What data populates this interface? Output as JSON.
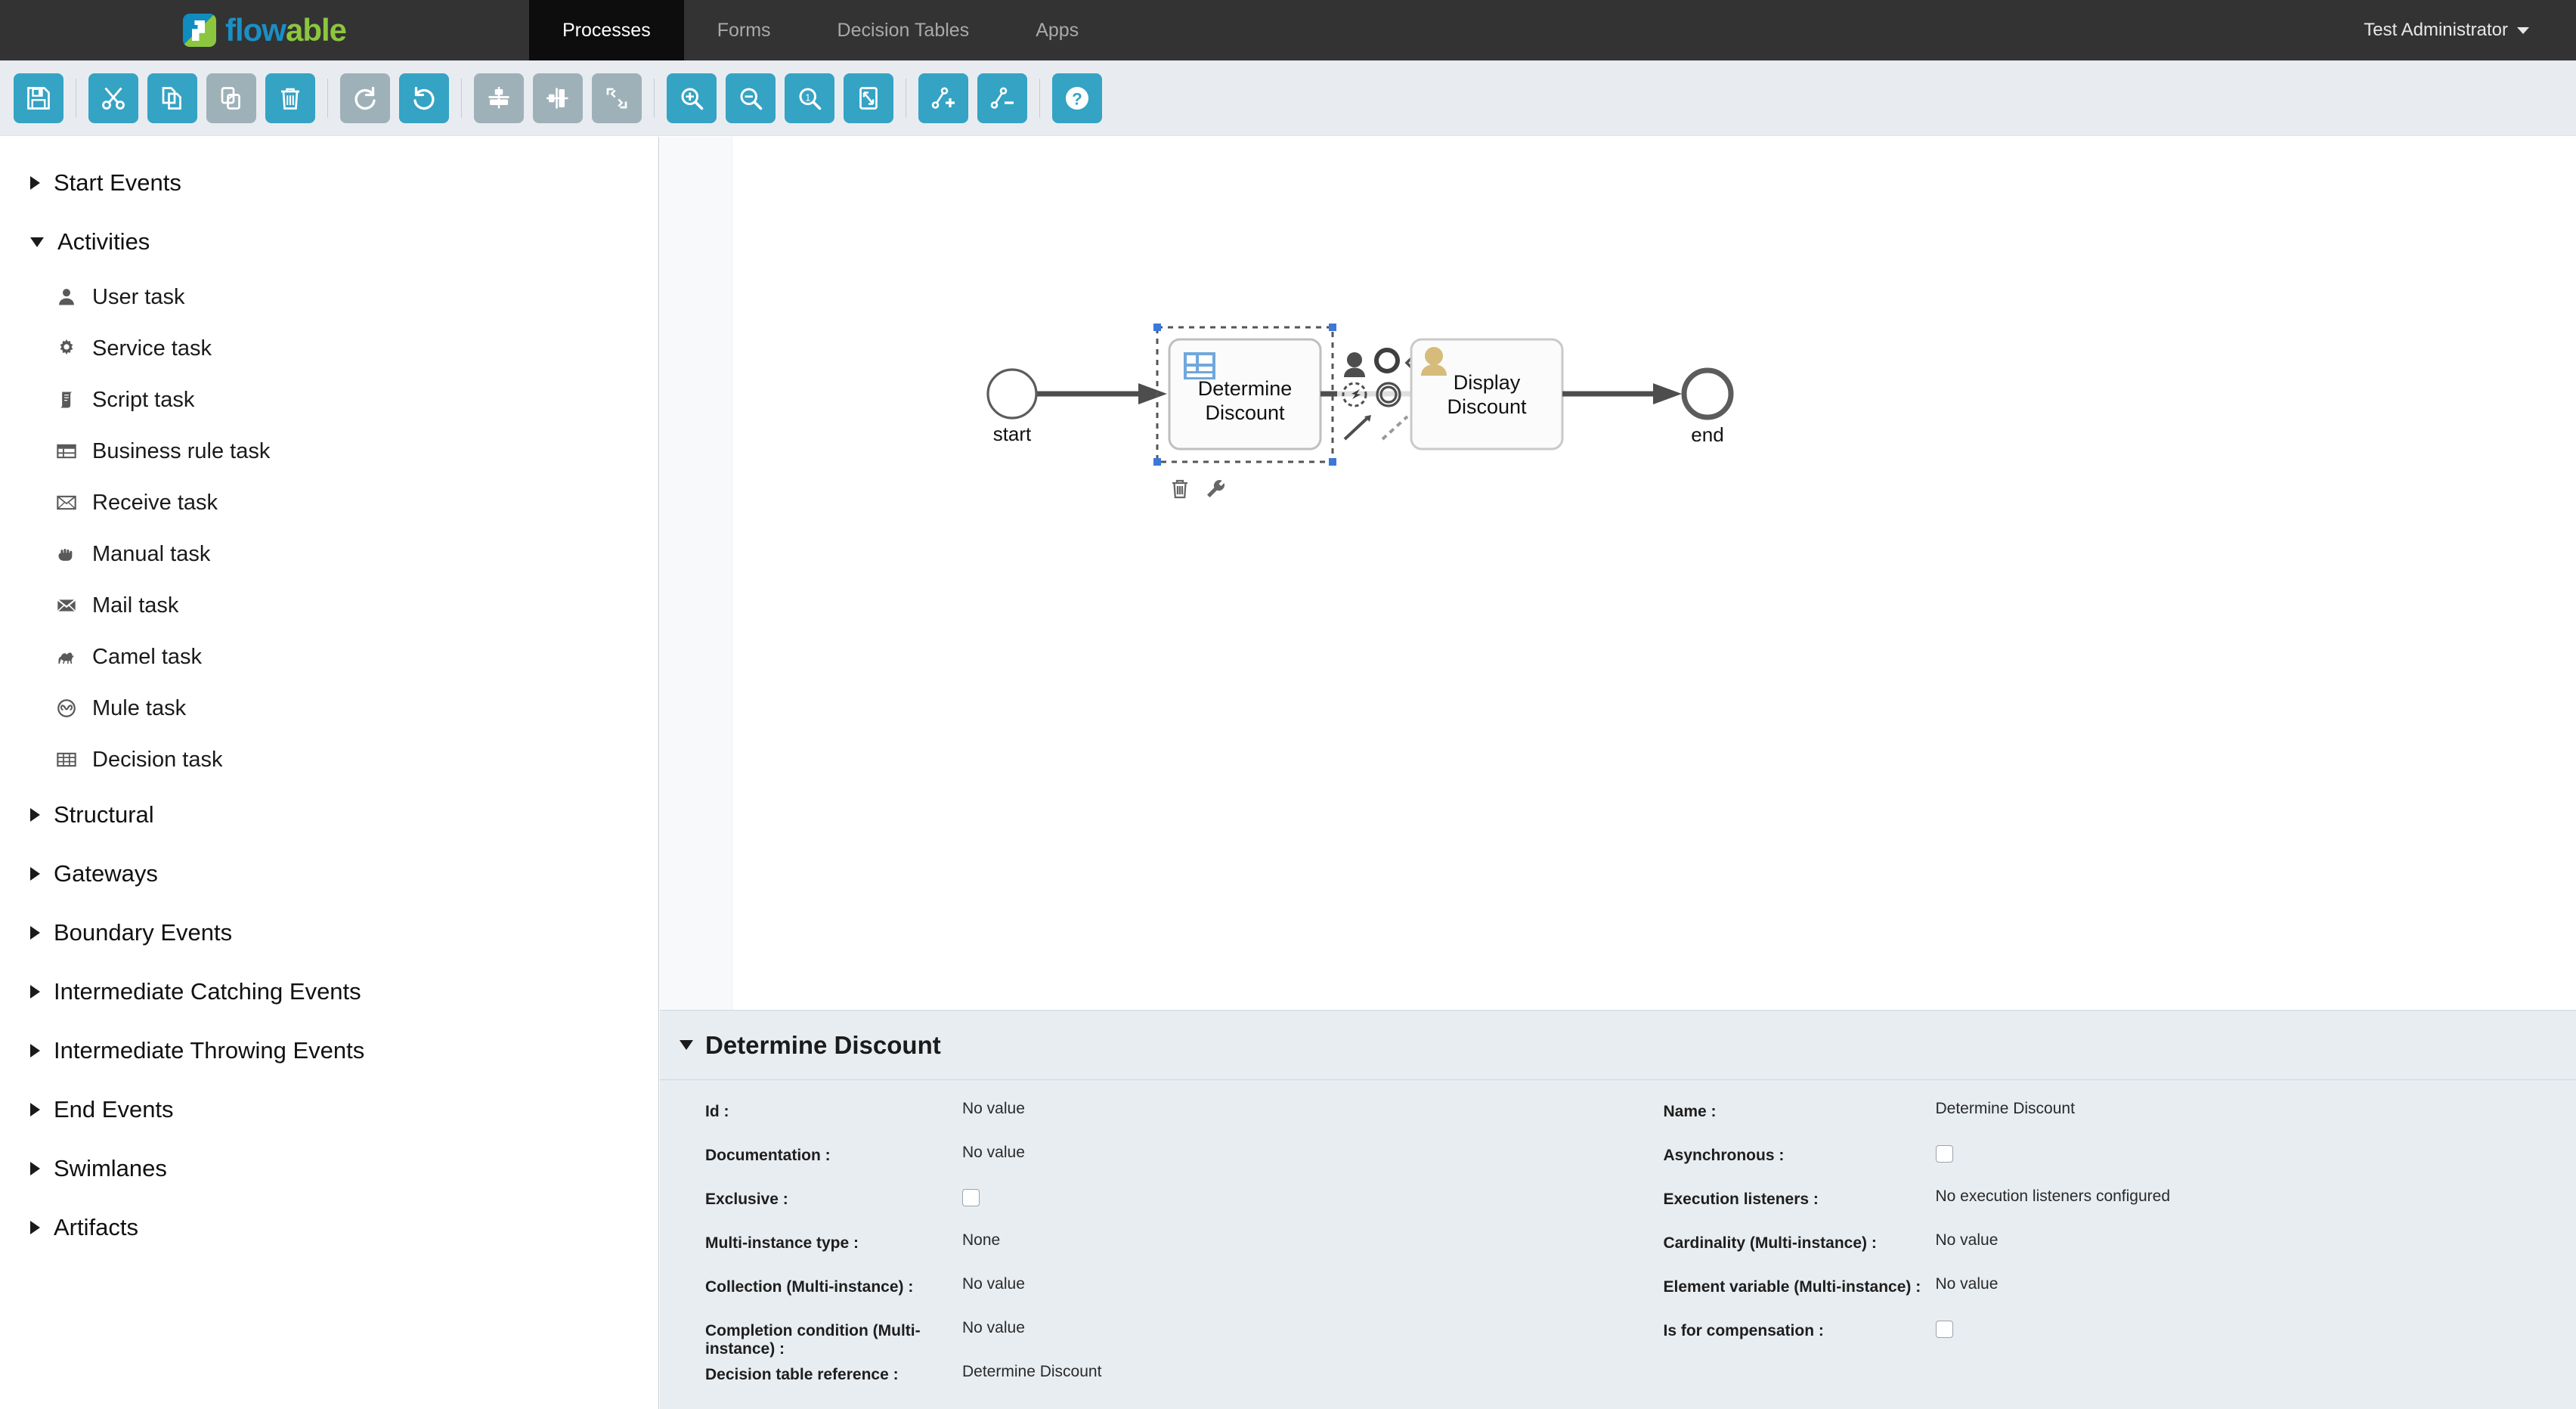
{
  "brand": {
    "name_blue": "flow",
    "name_green": "able",
    "logo_icon": "flowable-logo-icon"
  },
  "nav": {
    "tabs": [
      {
        "label": "Processes",
        "active": true
      },
      {
        "label": "Forms",
        "active": false
      },
      {
        "label": "Decision Tables",
        "active": false
      },
      {
        "label": "Apps",
        "active": false
      }
    ],
    "user": "Test Administrator"
  },
  "toolbar": {
    "colors": {
      "enabled": "#35a3c4",
      "disabled": "#9fb1b8",
      "background": "#e8ecf0"
    },
    "buttons": [
      {
        "name": "save-button",
        "icon": "save-icon",
        "enabled": true
      },
      {
        "sep": true
      },
      {
        "name": "cut-button",
        "icon": "scissors-icon",
        "enabled": true
      },
      {
        "name": "copy-button",
        "icon": "copy-icon",
        "enabled": true
      },
      {
        "name": "paste-button",
        "icon": "paste-icon",
        "enabled": false
      },
      {
        "name": "delete-button",
        "icon": "trash-icon",
        "enabled": true
      },
      {
        "sep": true
      },
      {
        "name": "redo-button",
        "icon": "redo-icon",
        "enabled": false
      },
      {
        "name": "undo-button",
        "icon": "undo-icon",
        "enabled": true
      },
      {
        "sep": true
      },
      {
        "name": "align-vertical-button",
        "icon": "align-vertical-icon",
        "enabled": false
      },
      {
        "name": "align-horizontal-button",
        "icon": "align-horizontal-icon",
        "enabled": false
      },
      {
        "name": "same-size-button",
        "icon": "same-size-icon",
        "enabled": false
      },
      {
        "sep": true
      },
      {
        "name": "zoom-in-button",
        "icon": "zoom-in-icon",
        "enabled": true
      },
      {
        "name": "zoom-out-button",
        "icon": "zoom-out-icon",
        "enabled": true
      },
      {
        "name": "zoom-actual-button",
        "icon": "zoom-actual-icon",
        "enabled": true
      },
      {
        "name": "zoom-fit-button",
        "icon": "zoom-fit-icon",
        "enabled": true
      },
      {
        "sep": true
      },
      {
        "name": "add-bendpoint-button",
        "icon": "add-bendpoint-icon",
        "enabled": true
      },
      {
        "name": "remove-bendpoint-button",
        "icon": "remove-bendpoint-icon",
        "enabled": true
      },
      {
        "sep": true
      },
      {
        "name": "help-button",
        "icon": "help-icon",
        "enabled": true
      }
    ]
  },
  "palette": {
    "groups": [
      {
        "label": "Start Events",
        "expanded": false,
        "items": []
      },
      {
        "label": "Activities",
        "expanded": true,
        "items": [
          {
            "label": "User task",
            "icon": "user-icon"
          },
          {
            "label": "Service task",
            "icon": "gear-icon"
          },
          {
            "label": "Script task",
            "icon": "script-icon"
          },
          {
            "label": "Business rule task",
            "icon": "table-icon"
          },
          {
            "label": "Receive task",
            "icon": "envelope-outline-icon"
          },
          {
            "label": "Manual task",
            "icon": "hand-icon"
          },
          {
            "label": "Mail task",
            "icon": "envelope-filled-icon"
          },
          {
            "label": "Camel task",
            "icon": "camel-icon"
          },
          {
            "label": "Mule task",
            "icon": "mule-icon"
          },
          {
            "label": "Decision task",
            "icon": "grid-icon"
          }
        ]
      },
      {
        "label": "Structural",
        "expanded": false,
        "items": []
      },
      {
        "label": "Gateways",
        "expanded": false,
        "items": []
      },
      {
        "label": "Boundary Events",
        "expanded": false,
        "items": []
      },
      {
        "label": "Intermediate Catching Events",
        "expanded": false,
        "items": []
      },
      {
        "label": "Intermediate Throwing Events",
        "expanded": false,
        "items": []
      },
      {
        "label": "End Events",
        "expanded": false,
        "items": []
      },
      {
        "label": "Swimlanes",
        "expanded": false,
        "items": []
      },
      {
        "label": "Artifacts",
        "expanded": false,
        "items": []
      }
    ]
  },
  "diagram": {
    "start_event_label": "start",
    "end_event_label": "end",
    "task1_line1": "Determine",
    "task1_line2": "Discount",
    "task1_selected": true,
    "task1_type_icon": "decision-table-icon",
    "task2_line1": "Display",
    "task2_line2": "Discount",
    "task2_type_icon": "user-task-icon",
    "quick_menu": [
      "user-task-quick-icon",
      "end-event-quick-icon",
      "exclusive-gateway-quick-icon",
      "boundary-event-quick-icon",
      "intermediate-event-quick-icon",
      "sequence-flow-quick-icon",
      "association-quick-icon",
      "text-annotation-quick-icon"
    ],
    "element_actions": [
      "delete-element-icon",
      "morph-element-icon"
    ]
  },
  "properties": {
    "title": "Determine Discount",
    "left": [
      {
        "label": "Id :",
        "value": "No value",
        "type": "text"
      },
      {
        "label": "Documentation :",
        "value": "No value",
        "type": "text"
      },
      {
        "label": "Exclusive :",
        "value": "",
        "type": "checkbox",
        "checked": false
      },
      {
        "label": "Multi-instance type :",
        "value": "None",
        "type": "text"
      },
      {
        "label": "Collection (Multi-instance) :",
        "value": "No value",
        "type": "text"
      },
      {
        "label": "Completion condition (Multi-instance) :",
        "value": "No value",
        "type": "text"
      },
      {
        "label": "Decision table reference :",
        "value": "Determine Discount",
        "type": "text"
      }
    ],
    "right": [
      {
        "label": "Name :",
        "value": "Determine Discount",
        "type": "text"
      },
      {
        "label": "Asynchronous :",
        "value": "",
        "type": "checkbox",
        "checked": false
      },
      {
        "label": "Execution listeners :",
        "value": "No execution listeners configured",
        "type": "text"
      },
      {
        "label": "Cardinality (Multi-instance) :",
        "value": "No value",
        "type": "text"
      },
      {
        "label": "Element variable (Multi-instance) :",
        "value": "No value",
        "type": "text"
      },
      {
        "label": "Is for compensation :",
        "value": "",
        "type": "checkbox",
        "checked": false
      }
    ]
  }
}
